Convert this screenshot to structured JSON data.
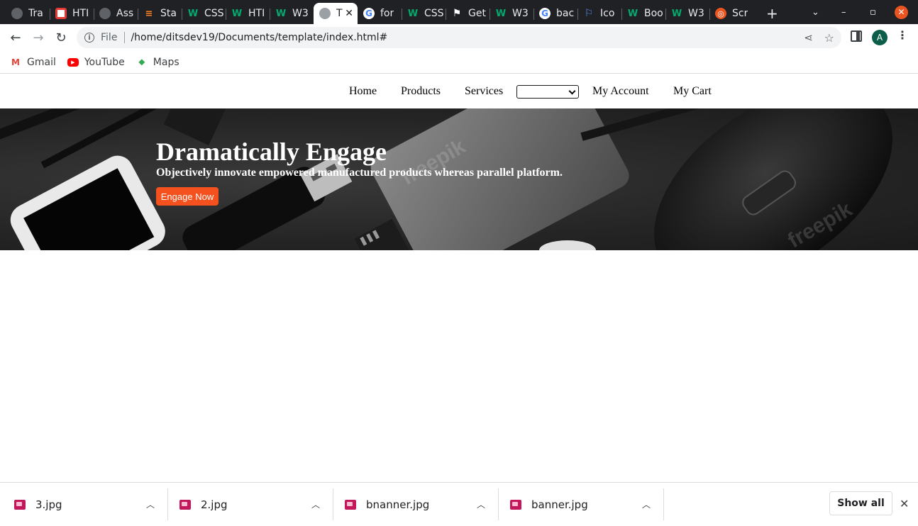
{
  "browser": {
    "tabs": [
      {
        "title": "Tra",
        "icon": "globe-icon"
      },
      {
        "title": "HTI",
        "icon": "opera-icon"
      },
      {
        "title": "Ass",
        "icon": "globe-icon"
      },
      {
        "title": "Sta",
        "icon": "stackoverflow-icon"
      },
      {
        "title": "CSS",
        "icon": "w3schools-icon"
      },
      {
        "title": "HTI",
        "icon": "w3schools-icon"
      },
      {
        "title": "W3",
        "icon": "w3schools-icon"
      },
      {
        "title": "T",
        "icon": "globe-icon",
        "active": true
      },
      {
        "title": "for",
        "icon": "google-icon"
      },
      {
        "title": "CSS",
        "icon": "w3schools-icon"
      },
      {
        "title": "Get",
        "icon": "flag-icon"
      },
      {
        "title": "W3",
        "icon": "w3schools-icon"
      },
      {
        "title": "bac",
        "icon": "google-icon"
      },
      {
        "title": "Ico",
        "icon": "bookmark-flag-icon"
      },
      {
        "title": "Boo",
        "icon": "w3schools-icon"
      },
      {
        "title": "W3",
        "icon": "w3schools-icon"
      },
      {
        "title": "Scr",
        "icon": "ubuntu-icon"
      }
    ],
    "url": {
      "scheme_label": "File",
      "path": "/home/ditsdev19/Documents/template/index.html#"
    },
    "profile_initial": "A",
    "bookmarks": [
      {
        "label": "Gmail",
        "icon": "gmail-icon"
      },
      {
        "label": "YouTube",
        "icon": "youtube-icon"
      },
      {
        "label": "Maps",
        "icon": "maps-icon"
      }
    ]
  },
  "site": {
    "nav": {
      "home": "Home",
      "products": "Products",
      "services": "Services",
      "select_value": "",
      "account": "My Account",
      "cart": "My Cart"
    },
    "hero": {
      "title": "Dramatically Engage",
      "subtitle": "Objectively innovate empowered manufactured products whereas parallel platform.",
      "button": "Engage Now",
      "button_color": "#f4511e",
      "watermark": "freepik"
    }
  },
  "downloads": {
    "items": [
      {
        "name": "3.jpg"
      },
      {
        "name": "2.jpg"
      },
      {
        "name": "bnanner.jpg"
      },
      {
        "name": "banner.jpg"
      }
    ],
    "show_all": "Show all"
  }
}
